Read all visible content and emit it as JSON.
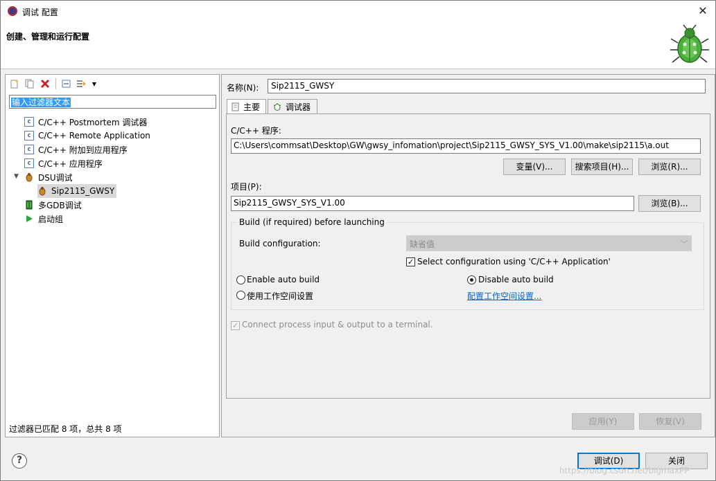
{
  "window": {
    "title": "调试 配置",
    "heading": "创建、管理和运行配置"
  },
  "left": {
    "filter_value": "输入过滤器文本",
    "tree": [
      {
        "label": "C/C++ Postmortem 调试器",
        "icon": "c-config-icon"
      },
      {
        "label": "C/C++ Remote Application",
        "icon": "c-config-icon"
      },
      {
        "label": "C/C++ 附加到应用程序",
        "icon": "c-config-icon"
      },
      {
        "label": "C/C++ 应用程序",
        "icon": "c-config-icon"
      },
      {
        "label": "DSU调试",
        "icon": "bug-icon",
        "expanded": true
      },
      {
        "label": "Sip2115_GWSY",
        "icon": "bug-icon",
        "selected": true
      },
      {
        "label": "多GDB调试",
        "icon": "gdb-icon"
      },
      {
        "label": "启动组",
        "icon": "launch-group-icon"
      }
    ],
    "status": "过滤器已匹配 8 项，总共 8 项"
  },
  "right": {
    "name_label": "名称(N):",
    "name_value": "Sip2115_GWSY",
    "tabs": [
      {
        "label": "主要",
        "active": true
      },
      {
        "label": "调试器",
        "active": false
      }
    ],
    "program_label": "C/C++ 程序:",
    "program_value": "C:\\Users\\commsat\\Desktop\\GW\\gwsy_infomation\\project\\Sip2115_GWSY_SYS_V1.00\\make\\sip2115\\a.out",
    "btn_variables": "变量(V)...",
    "btn_search_project": "搜索项目(H)...",
    "btn_browse1": "浏览(R)...",
    "project_label": "项目(P):",
    "project_value": "Sip2115_GWSY_SYS_V1.00",
    "btn_browse2": "浏览(B)...",
    "build_group_title": "Build (if required) before launching",
    "build_config_label": "Build configuration:",
    "build_config_value": "缺省值",
    "select_config_label": "Select configuration using 'C/C++ Application'",
    "enable_auto_build": "Enable auto build",
    "disable_auto_build": "Disable auto build",
    "use_workspace": "使用工作空间设置",
    "configure_workspace_link": "配置工作空间设置...",
    "connect_terminal": "Connect process input & output to a terminal.",
    "btn_apply": "应用(Y)",
    "btn_revert": "恢复(V)"
  },
  "footer": {
    "btn_debug": "调试(D)",
    "btn_close": "关闭",
    "watermark": "https://blog.csdn.net/bigmaxPP"
  },
  "colors": {
    "selection": "#3399ff",
    "link": "#0066cc",
    "primary_border": "#0078d7"
  }
}
